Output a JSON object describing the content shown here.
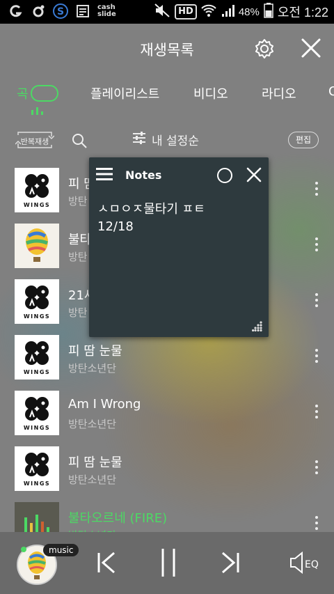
{
  "status": {
    "battery": "48%",
    "clock": "오전 1:22",
    "hd": "HD",
    "cash_line1": "cash",
    "cash_line2": "slide"
  },
  "header": {
    "title": "재생목록"
  },
  "tabs": [
    {
      "label": "곡"
    },
    {
      "label": "플레이리스트"
    },
    {
      "label": "비디오"
    },
    {
      "label": "라디오"
    }
  ],
  "toolbar": {
    "repeat_label": "반복재생",
    "sort_label": "내 설정순",
    "edit_label": "편집"
  },
  "songs": [
    {
      "title": "피 땀",
      "artist": "방탄",
      "art": "wings"
    },
    {
      "title": "불타",
      "artist": "방탄",
      "art": "balloon"
    },
    {
      "title": "21세",
      "artist": "방탄",
      "art": "wings"
    },
    {
      "title": "피 땀 눈물",
      "artist": "방탄소년단",
      "art": "wings"
    },
    {
      "title": "Am I Wrong",
      "artist": "방탄소년단",
      "art": "wings"
    },
    {
      "title": "피 땀 눈물",
      "artist": "방탄소년단",
      "art": "wings"
    },
    {
      "title": "불타오르네 (FIRE)",
      "artist": "방탄소년단",
      "art": "fire",
      "playing": true
    }
  ],
  "album_text": "WINGS",
  "notes": {
    "title": "Notes",
    "body": "ㅅㅁㅇㅈ물타기 ㅍㅌ\n12/18"
  },
  "player": {
    "music_tag": "music",
    "eq_label": "EQ"
  },
  "colors": {
    "accent": "#4cd964",
    "notes_bg": "#2e3a3e"
  }
}
